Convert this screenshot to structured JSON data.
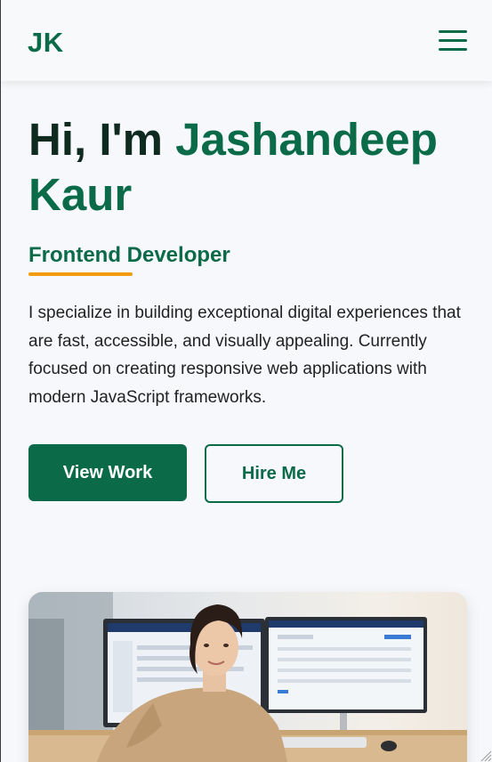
{
  "header": {
    "logo": "JK",
    "menu_icon": "hamburger-menu-icon"
  },
  "hero": {
    "greeting": "Hi, I'm ",
    "name": "Jashandeep Kaur",
    "role": "Frontend Developer",
    "intro": "I specialize in building exceptional digital experiences that are fast, accessible, and visually appealing. Currently focused on creating responsive web applications with modern JavaScript frameworks."
  },
  "buttons": {
    "primary": "View Work",
    "secondary": "Hire Me"
  },
  "colors": {
    "accent": "#0b6b49",
    "heading": "#0f2a1e",
    "underline": "#f39c12",
    "background": "#f7f8fb"
  }
}
